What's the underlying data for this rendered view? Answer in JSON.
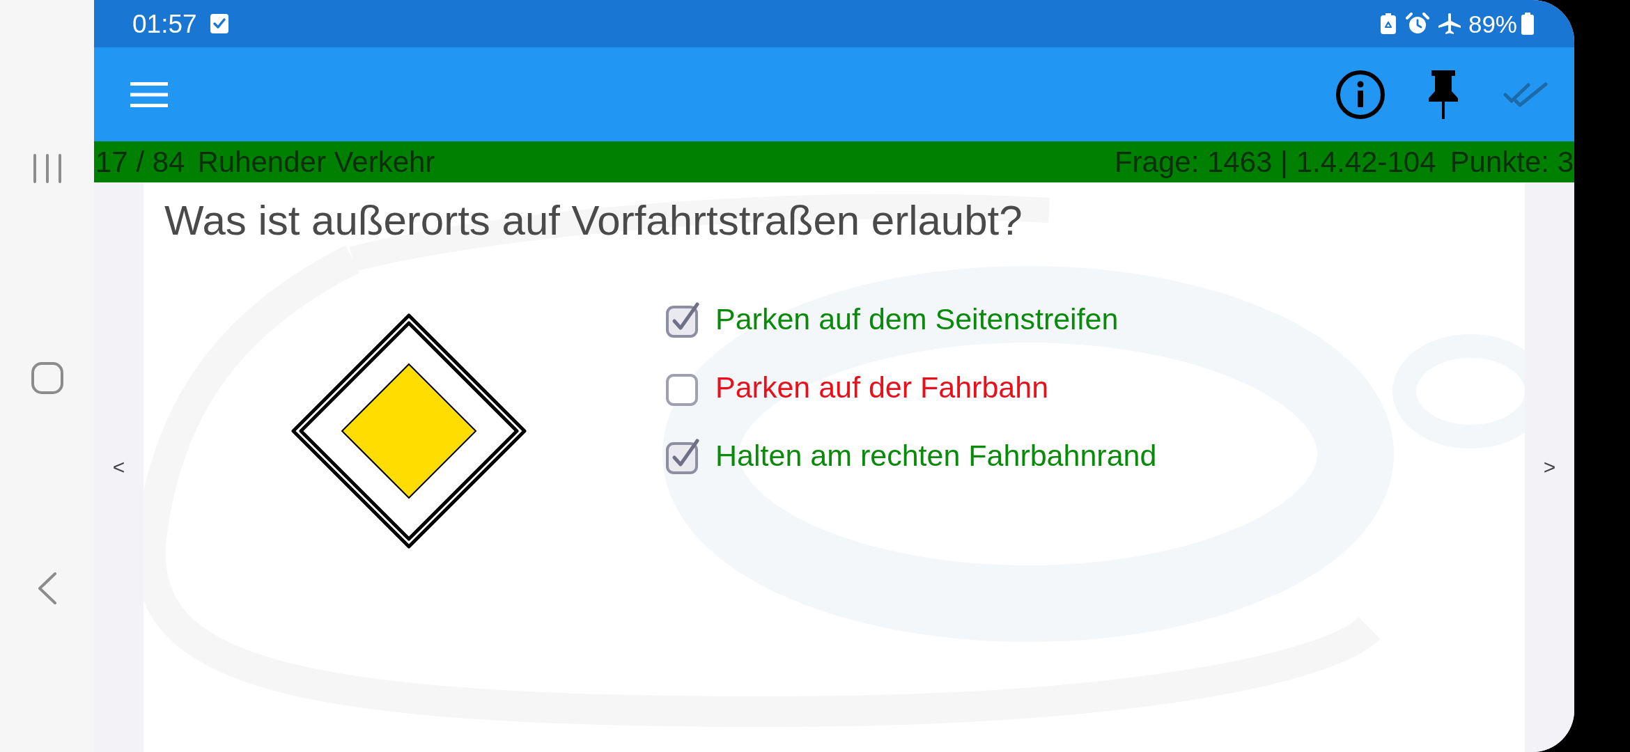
{
  "status_bar": {
    "time": "01:57",
    "battery": "89%"
  },
  "toolbar": {
    "actions": [
      {
        "kind": "info",
        "disabled": false
      },
      {
        "kind": "pin",
        "disabled": false
      },
      {
        "kind": "done",
        "disabled": true
      }
    ]
  },
  "progress": {
    "position": "17 / 84",
    "topic": "Ruhender Verkehr",
    "question_ref": "Frage: 1463 | 1.4.42-104",
    "points": "Punkte: 3"
  },
  "navigation": {
    "previous": "<",
    "next": ">"
  },
  "question": {
    "text": "Was ist außerorts auf Vorfahrtstraßen erlaubt?",
    "answers": [
      {
        "text": "Parken auf dem Seitenstreifen",
        "checked": true,
        "correct": true
      },
      {
        "text": "Parken auf der Fahrbahn",
        "checked": false,
        "correct": false
      },
      {
        "text": "Halten am rechten Fahrbahnrand",
        "checked": true,
        "correct": true
      }
    ]
  }
}
